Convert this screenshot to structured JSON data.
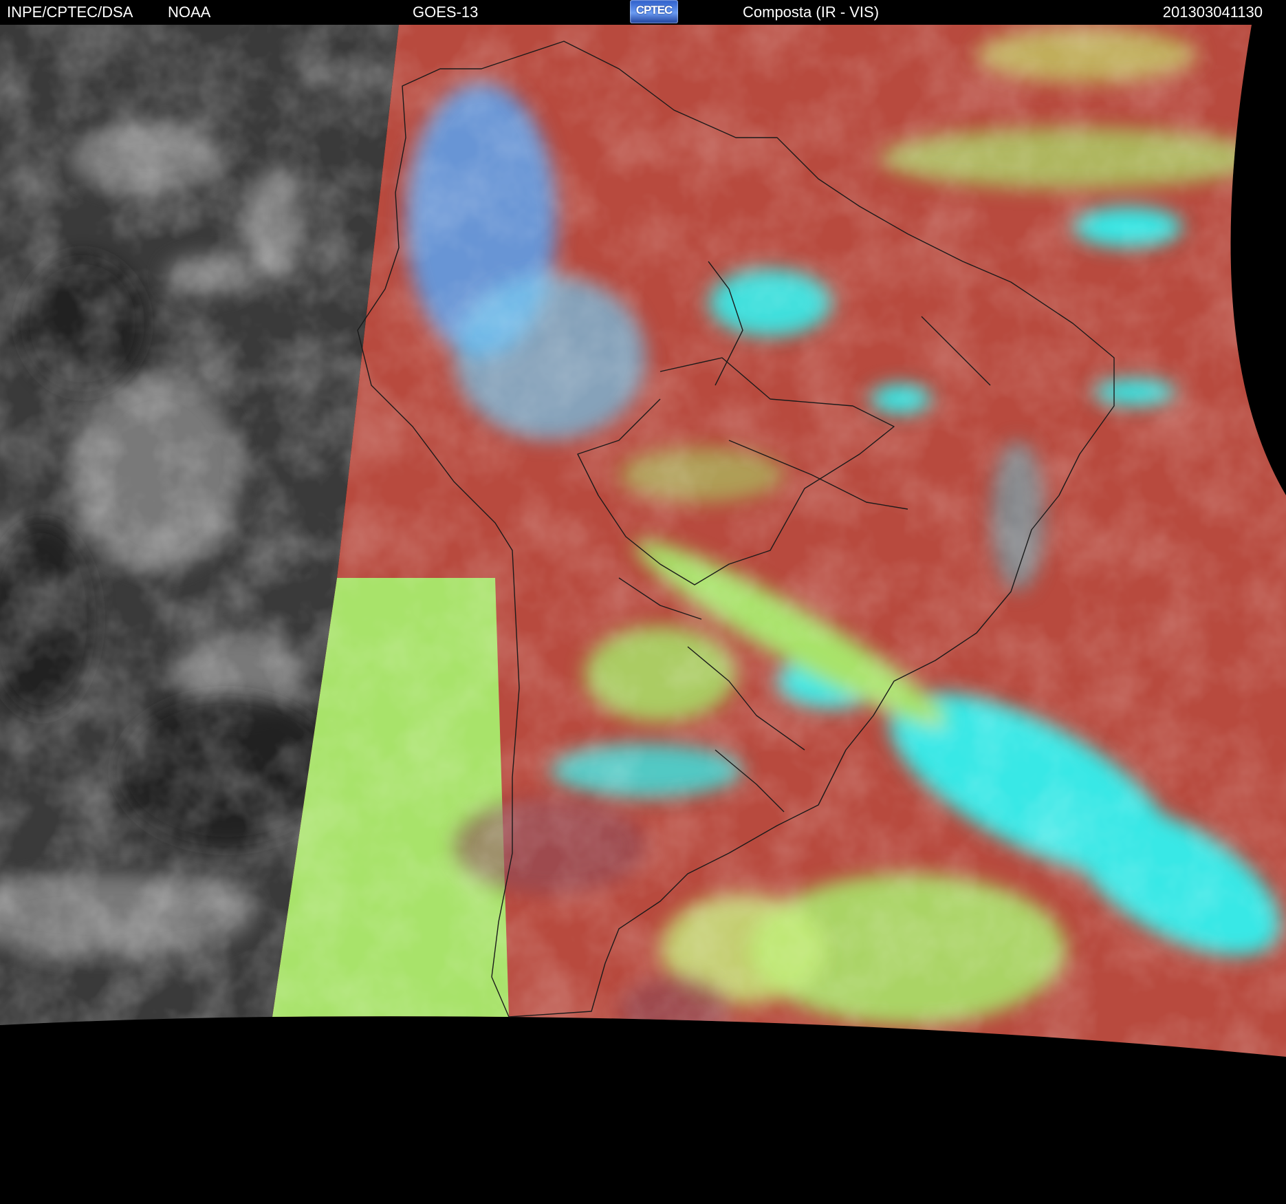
{
  "header": {
    "organization": "INPE/CPTEC/DSA",
    "agency": "NOAA",
    "satellite": "GOES-13",
    "logo_text": "CPTEC",
    "product": "Composta (IR - VIS)",
    "timestamp": "201303041130"
  },
  "colors": {
    "background": "#000000",
    "header_text": "#ffffff",
    "ir_greyscale": "#3a3a3a",
    "composite_red": "#b84a3e",
    "composite_green": "#a8e36a",
    "composite_cyan": "#38e8e6",
    "composite_blue": "#5aa2f0",
    "borders": "#1a1a1a"
  }
}
